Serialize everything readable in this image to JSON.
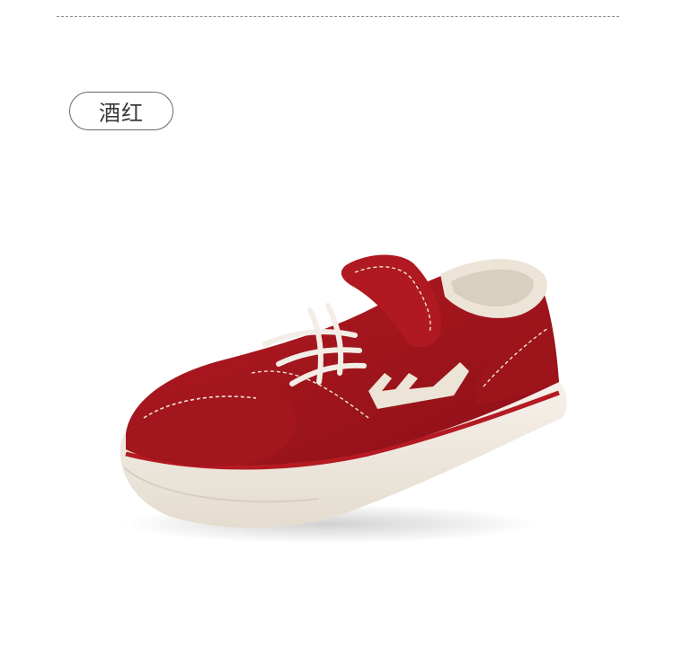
{
  "color_tag": {
    "label": "酒红"
  },
  "product": {
    "image": "red-kids-sneaker"
  },
  "colors": {
    "divider": "#8a8a8a",
    "tag_border": "#6a6a6a",
    "tag_text": "#3a3a3a",
    "shoe_red": "#a8151d",
    "shoe_red_dark": "#7d0e14",
    "sole_cream": "#f1ebe2",
    "logo_cream": "#ede5d8"
  }
}
